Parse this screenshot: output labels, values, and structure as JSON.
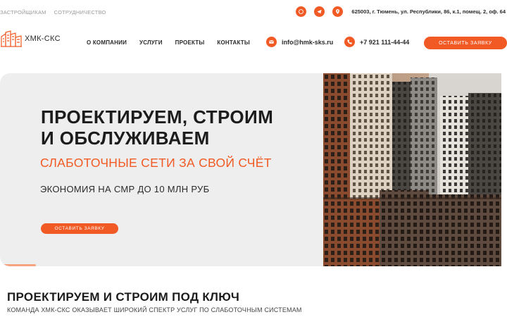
{
  "topbar": {
    "links": [
      "ЗАСТРОЙЩИКАМ",
      "СОТРУДНИЧЕСТВО"
    ],
    "icons": [
      "whatsapp-icon",
      "telegram-icon",
      "location-pin-icon"
    ],
    "address": "625003, г. Тюмень, ул. Республики, 86, к.1, помещ. 2, оф. 64"
  },
  "header": {
    "logo_text": "ХМК-СКС",
    "nav": [
      "О КОМПАНИИ",
      "УСЛУГИ",
      "ПРОЕКТЫ",
      "КОНТАКТЫ"
    ],
    "email": "info@hmk-sks.ru",
    "phone": "+7 921 111-44-44",
    "cta_label": "ОСТАВИТЬ ЗАЯВКУ"
  },
  "hero": {
    "title_line1": "ПРОЕКТИРУЕМ, СТРОИМ",
    "title_line2": "И ОБСЛУЖИВАЕМ",
    "subtitle": "СЛАБОТОЧНЫЕ СЕТИ ЗА СВОЙ СЧЁТ",
    "economy": "ЭКОНОМИЯ НА СМР ДО 10 МЛН РУБ",
    "cta_label": "ОСТАВИТЬ ЗАЯВКУ",
    "slide_progress": 0.17
  },
  "section": {
    "title": "ПРОЕКТИРУЕМ И СТРОИМ ПОД КЛЮЧ",
    "description": "КОМАНДА ХМК-СКС ОКАЗЫВАЕТ ШИРОКИЙ СПЕКТР УСЛУГ ПО СЛАБОТОЧНЫМ СИСТЕМАМ"
  },
  "colors": {
    "accent": "#f15a24",
    "hero_bg": "#eeeeee",
    "text_dark": "#1c1c1c"
  }
}
